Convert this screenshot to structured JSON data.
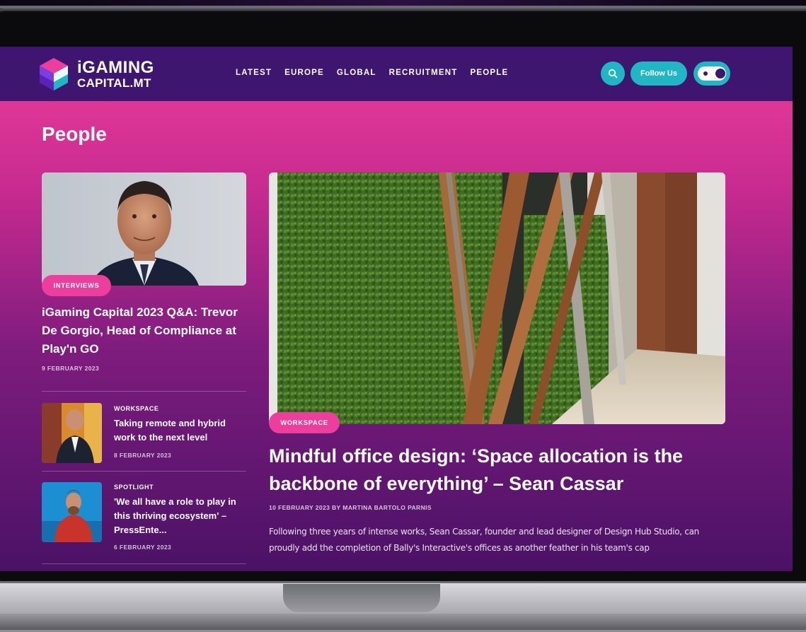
{
  "brand": {
    "line1": "iGAMING",
    "line2": "CAPITAL.MT",
    "colors": {
      "header": "#3e1670",
      "accent_teal": "#1fb7c3",
      "pink": "#ec3e9c"
    }
  },
  "nav": {
    "items": [
      {
        "label": "LATEST"
      },
      {
        "label": "EUROPE"
      },
      {
        "label": "GLOBAL"
      },
      {
        "label": "RECRUITMENT"
      },
      {
        "label": "PEOPLE"
      }
    ]
  },
  "header_actions": {
    "search_icon": "search-icon",
    "follow_label": "Follow Us",
    "toggle_icon": "theme-toggle"
  },
  "page": {
    "title": "People"
  },
  "lead_article": {
    "category": "INTERVIEWS",
    "title": "iGaming Capital 2023 Q&A: Trevor De Gorgio, Head of Compliance at Play'n GO",
    "date": "9 FEBRUARY 2023"
  },
  "side_articles": [
    {
      "category": "WORKSPACE",
      "title": "Taking remote and hybrid work to the next level",
      "date": "8 FEBRUARY 2023"
    },
    {
      "category": "SPOTLIGHT",
      "title": "'We all have a role to play in this thriving ecosystem' – PressEnte...",
      "date": "6 FEBRUARY 2023"
    }
  ],
  "feature": {
    "category": "WORKSPACE",
    "title": "Mindful office design: ‘Space allocation is the backbone of everything’ – Sean Cassar",
    "meta": "10 FEBRUARY 2023   BY MARTINA BARTOLO PARNIS",
    "excerpt": "Following three years of intense works, Sean Cassar, founder and lead designer of Design Hub Studio, can proudly add the completion of Bally's Interactive's offices as another feather in his team's cap"
  }
}
